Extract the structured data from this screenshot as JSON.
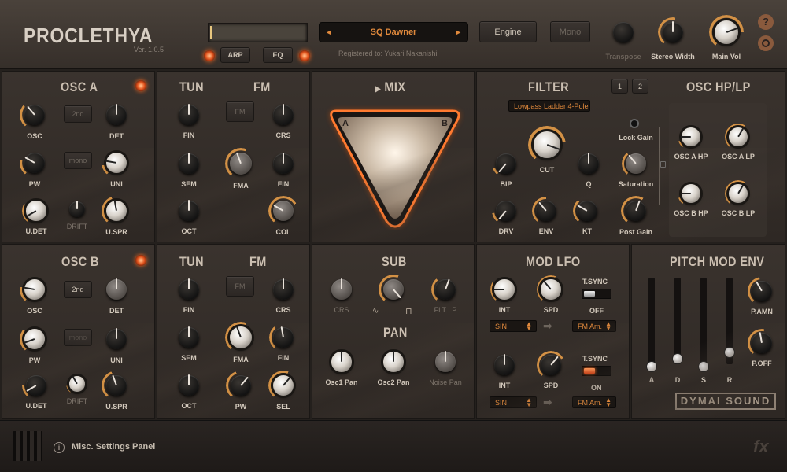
{
  "app": {
    "logo": "PROCLETHYA",
    "version": "Ver. 1.0.5"
  },
  "top": {
    "preset_name": "SQ Dawner",
    "prev_arrow": "◄",
    "next_arrow": "►",
    "registered": "Registered to: Yukari Nakanishi",
    "arp_label": "ARP",
    "eq_label": "EQ",
    "engine_label": "Engine",
    "mono_label": "Mono",
    "transpose_label": "Transpose",
    "stereo_width_label": "Stereo Width",
    "main_vol_label": "Main Vol",
    "help_icon": "?"
  },
  "osc_a": {
    "title": "OSC A",
    "btn_2nd": "2nd",
    "btn_mono": "mono",
    "labels": {
      "osc": "OSC",
      "det": "DET",
      "pw": "PW",
      "uni": "UNI",
      "udet": "U.DET",
      "drift": "DRIFT",
      "uspr": "U.SPR"
    }
  },
  "tunfm_a": {
    "title_tun": "TUN",
    "title_fm": "FM",
    "fm_btn": "FM",
    "labels": {
      "fin": "FIN",
      "crs": "CRS",
      "sem": "SEM",
      "fma": "FMA",
      "fin2": "FIN",
      "oct": "OCT",
      "col": "COL"
    }
  },
  "mix": {
    "title": "MIX",
    "title_icon": "▶",
    "a": "A",
    "b": "B"
  },
  "filter": {
    "title": "FILTER",
    "type": "Lowpass Ladder 4-Pole",
    "tab1": "1",
    "tab2": "2",
    "labels": {
      "bip": "BIP",
      "cut": "CUT",
      "q": "Q",
      "drv": "DRV",
      "env": "ENV",
      "kt": "KT",
      "lock_gain": "Lock Gain",
      "saturation": "Saturation",
      "post_gain": "Post Gain"
    }
  },
  "osc_hplp": {
    "title": "OSC HP/LP",
    "labels": {
      "a_hp": "OSC A HP",
      "a_lp": "OSC A LP",
      "b_hp": "OSC B HP",
      "b_lp": "OSC B LP"
    }
  },
  "osc_b": {
    "title": "OSC B",
    "btn_2nd": "2nd",
    "btn_mono": "mono",
    "labels": {
      "osc": "OSC",
      "det": "DET",
      "pw": "PW",
      "uni": "UNI",
      "udet": "U.DET",
      "drift": "DRIFT",
      "uspr": "U.SPR"
    }
  },
  "tunfm_b": {
    "title_tun": "TUN",
    "title_fm": "FM",
    "fm_btn": "FM",
    "labels": {
      "fin": "FIN",
      "crs": "CRS",
      "sem": "SEM",
      "fma": "FMA",
      "fin2": "FIN",
      "oct": "OCT",
      "pw": "PW",
      "sel": "SEL"
    }
  },
  "sub": {
    "title": "SUB",
    "labels": {
      "crs": "CRS",
      "flt_lp": "FLT LP"
    }
  },
  "pan": {
    "title": "PAN",
    "labels": {
      "osc1": "Osc1 Pan",
      "osc2": "Osc2 Pan",
      "noise": "Noise Pan"
    }
  },
  "mod_lfo": {
    "title": "MOD LFO",
    "row1": {
      "int": "INT",
      "spd": "SPD",
      "tsync": "T.SYNC",
      "state": "OFF",
      "shape": "SIN",
      "dest": "FM Am."
    },
    "row2": {
      "int": "INT",
      "spd": "SPD",
      "tsync": "T.SYNC",
      "state": "ON",
      "shape": "SIN",
      "dest": "FM Am."
    }
  },
  "pitch_env": {
    "title": "PITCH MOD ENV",
    "labels": {
      "a": "A",
      "d": "D",
      "s": "S",
      "r": "R",
      "pamn": "P.AMN",
      "poff": "P.OFF"
    },
    "brand": "DYMAI SOUND"
  },
  "bottom": {
    "info_icon": "i",
    "settings_label": "Misc. Settings Panel",
    "fx_label": "fx"
  }
}
